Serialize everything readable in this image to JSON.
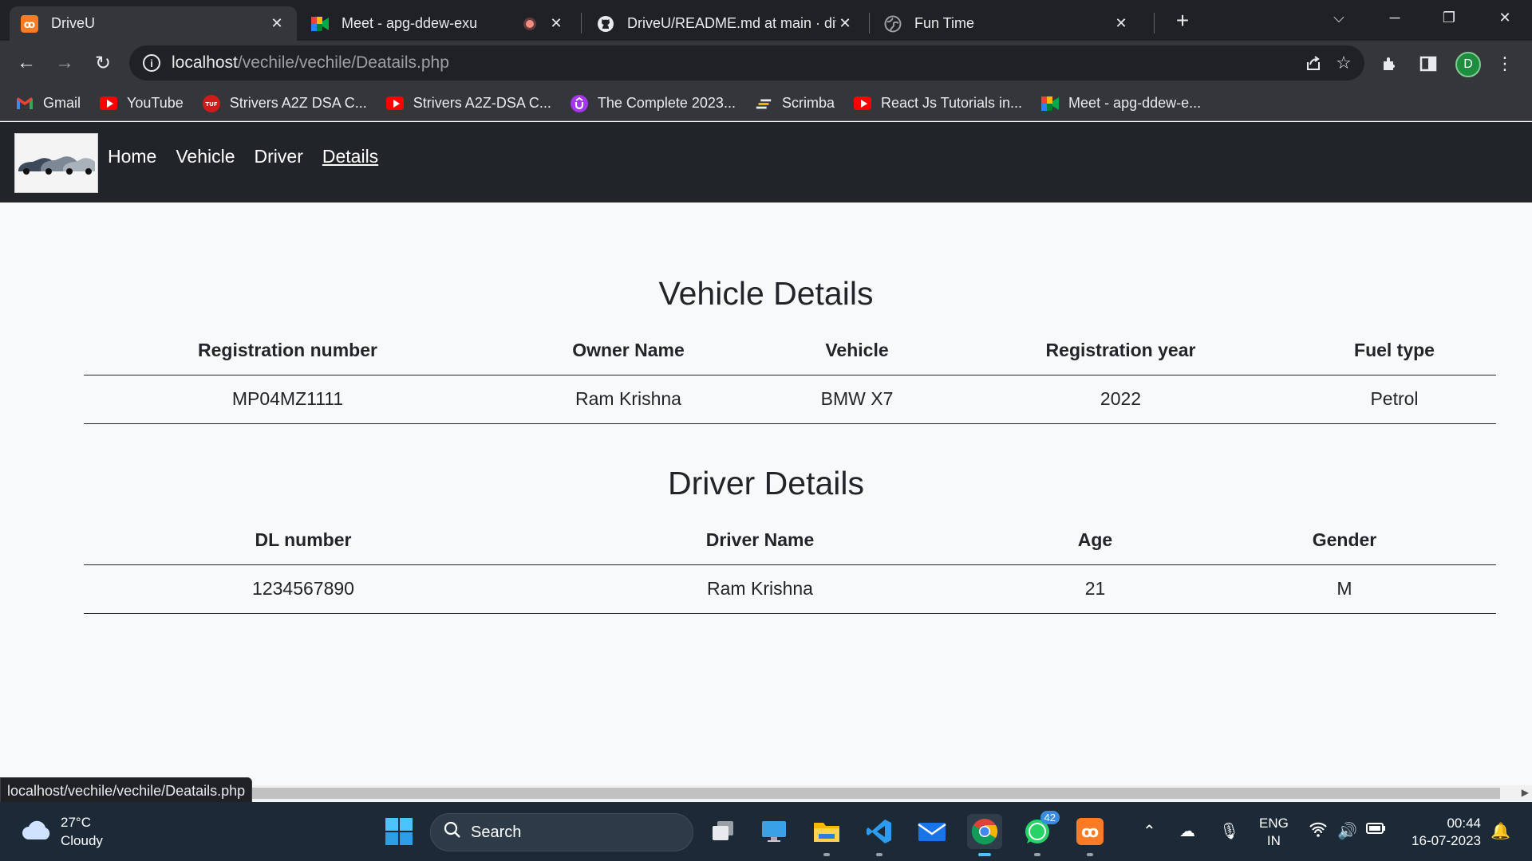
{
  "browser": {
    "tabs": [
      {
        "title": "DriveU",
        "icon": "xampp-icon",
        "active": true
      },
      {
        "title": "Meet - apg-ddew-exu",
        "icon": "meet-icon",
        "recording": true
      },
      {
        "title": "DriveU/README.md at main · div",
        "icon": "github-icon"
      },
      {
        "title": "Fun Time",
        "icon": "globe-icon"
      }
    ],
    "new_tab": "+",
    "url_host": "localhost",
    "url_path": "/vechile/vechile/Deatails.php",
    "profile_initial": "D",
    "bookmarks": [
      {
        "label": "Gmail",
        "icon": "gmail-icon"
      },
      {
        "label": "YouTube",
        "icon": "youtube-icon"
      },
      {
        "label": "Strivers A2Z DSA C...",
        "icon": "tuf-icon"
      },
      {
        "label": "Strivers A2Z-DSA C...",
        "icon": "youtube-icon"
      },
      {
        "label": "The Complete 2023...",
        "icon": "udemy-icon"
      },
      {
        "label": "Scrimba",
        "icon": "scrimba-icon"
      },
      {
        "label": "React Js Tutorials in...",
        "icon": "youtube-icon"
      },
      {
        "label": "Meet - apg-ddew-e...",
        "icon": "meet-icon"
      }
    ],
    "status_url": "localhost/vechile/vechile/Deatails.php"
  },
  "site": {
    "nav": [
      "Home",
      "Vehicle",
      "Driver",
      "Details"
    ],
    "current": "Details"
  },
  "vehicle": {
    "title": "Vehicle Details",
    "headers": [
      "Registration number",
      "Owner Name",
      "Vehicle",
      "Registration year",
      "Fuel type"
    ],
    "row": [
      "MP04MZ1111",
      "Ram Krishna",
      "BMW X7",
      "2022",
      "Petrol"
    ]
  },
  "driver": {
    "title": "Driver Details",
    "headers": [
      "DL number",
      "Driver Name",
      "Age",
      "Gender"
    ],
    "row": [
      "1234567890",
      "Ram Krishna",
      "21",
      "M"
    ]
  },
  "taskbar": {
    "temp": "27°C",
    "weather": "Cloudy",
    "search": "Search",
    "whatsapp_badge": "42",
    "lang_top": "ENG",
    "lang_bottom": "IN",
    "time": "00:44",
    "date": "16-07-2023"
  }
}
